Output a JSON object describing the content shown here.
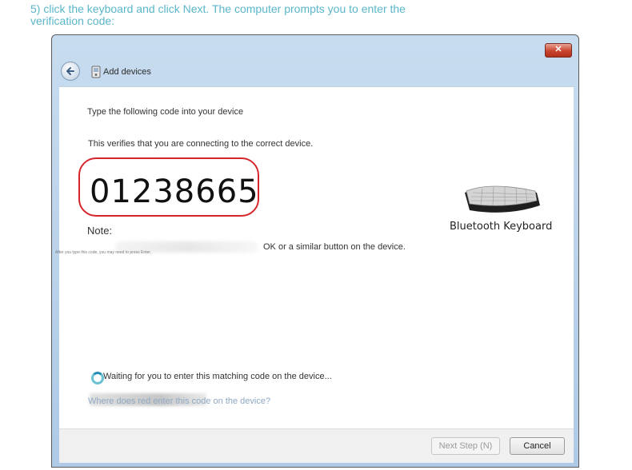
{
  "caption": "5) click the keyboard and click Next. The computer prompts you to enter the verification code:",
  "window": {
    "title": "Add devices",
    "close_label": "✕"
  },
  "content": {
    "instruction": "Type the following code into your device",
    "verify_text": "This verifies that you are connecting to the correct device.",
    "code": "01238665",
    "device_name": "Bluetooth Keyboard",
    "note_label": "Note:",
    "note_small": "After you type this code, you may need to press Enter,",
    "note_text": "OK or a similar button on the device.",
    "waiting_text": "Waiting for you to enter this matching code on the device...",
    "help_link": "Where does red enter this code on the device?"
  },
  "footer": {
    "next_label": "Next Step (N)",
    "cancel_label": "Cancel"
  },
  "colors": {
    "caption": "#5bb6c9",
    "highlight_border": "#d6262b",
    "link": "#8fa8c3"
  },
  "icons": {
    "back": "back-arrow-icon",
    "title": "bluetooth-device-icon",
    "device": "keyboard-icon",
    "status": "spinner-icon"
  }
}
